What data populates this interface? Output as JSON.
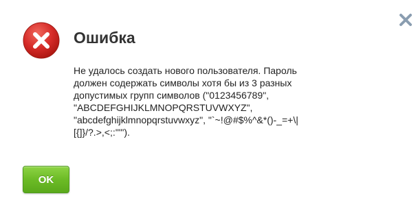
{
  "dialog": {
    "title": "Ошибка",
    "message_lines": [
      "Не удалось создать нового пользователя. Пароль",
      "должен содержать символы хотя бы из 3 разных",
      "допустимых групп символов (\"0123456789\",",
      "\"ABCDEFGHIJKLMNOPQRSTUVWXYZ\",",
      "\"abcdefghijklmnopqrstuvwxyz\", \"`~!@#$%^&*()-_=+\\|",
      "[{]}/?.>,<;:'\"\")."
    ],
    "ok_label": "OK",
    "icons": {
      "error": "error-circle-x-icon",
      "close": "close-x-icon"
    },
    "colors": {
      "error_red": "#d62b28",
      "ok_green": "#6cbb26",
      "close_gray": "#8a9db0"
    }
  }
}
